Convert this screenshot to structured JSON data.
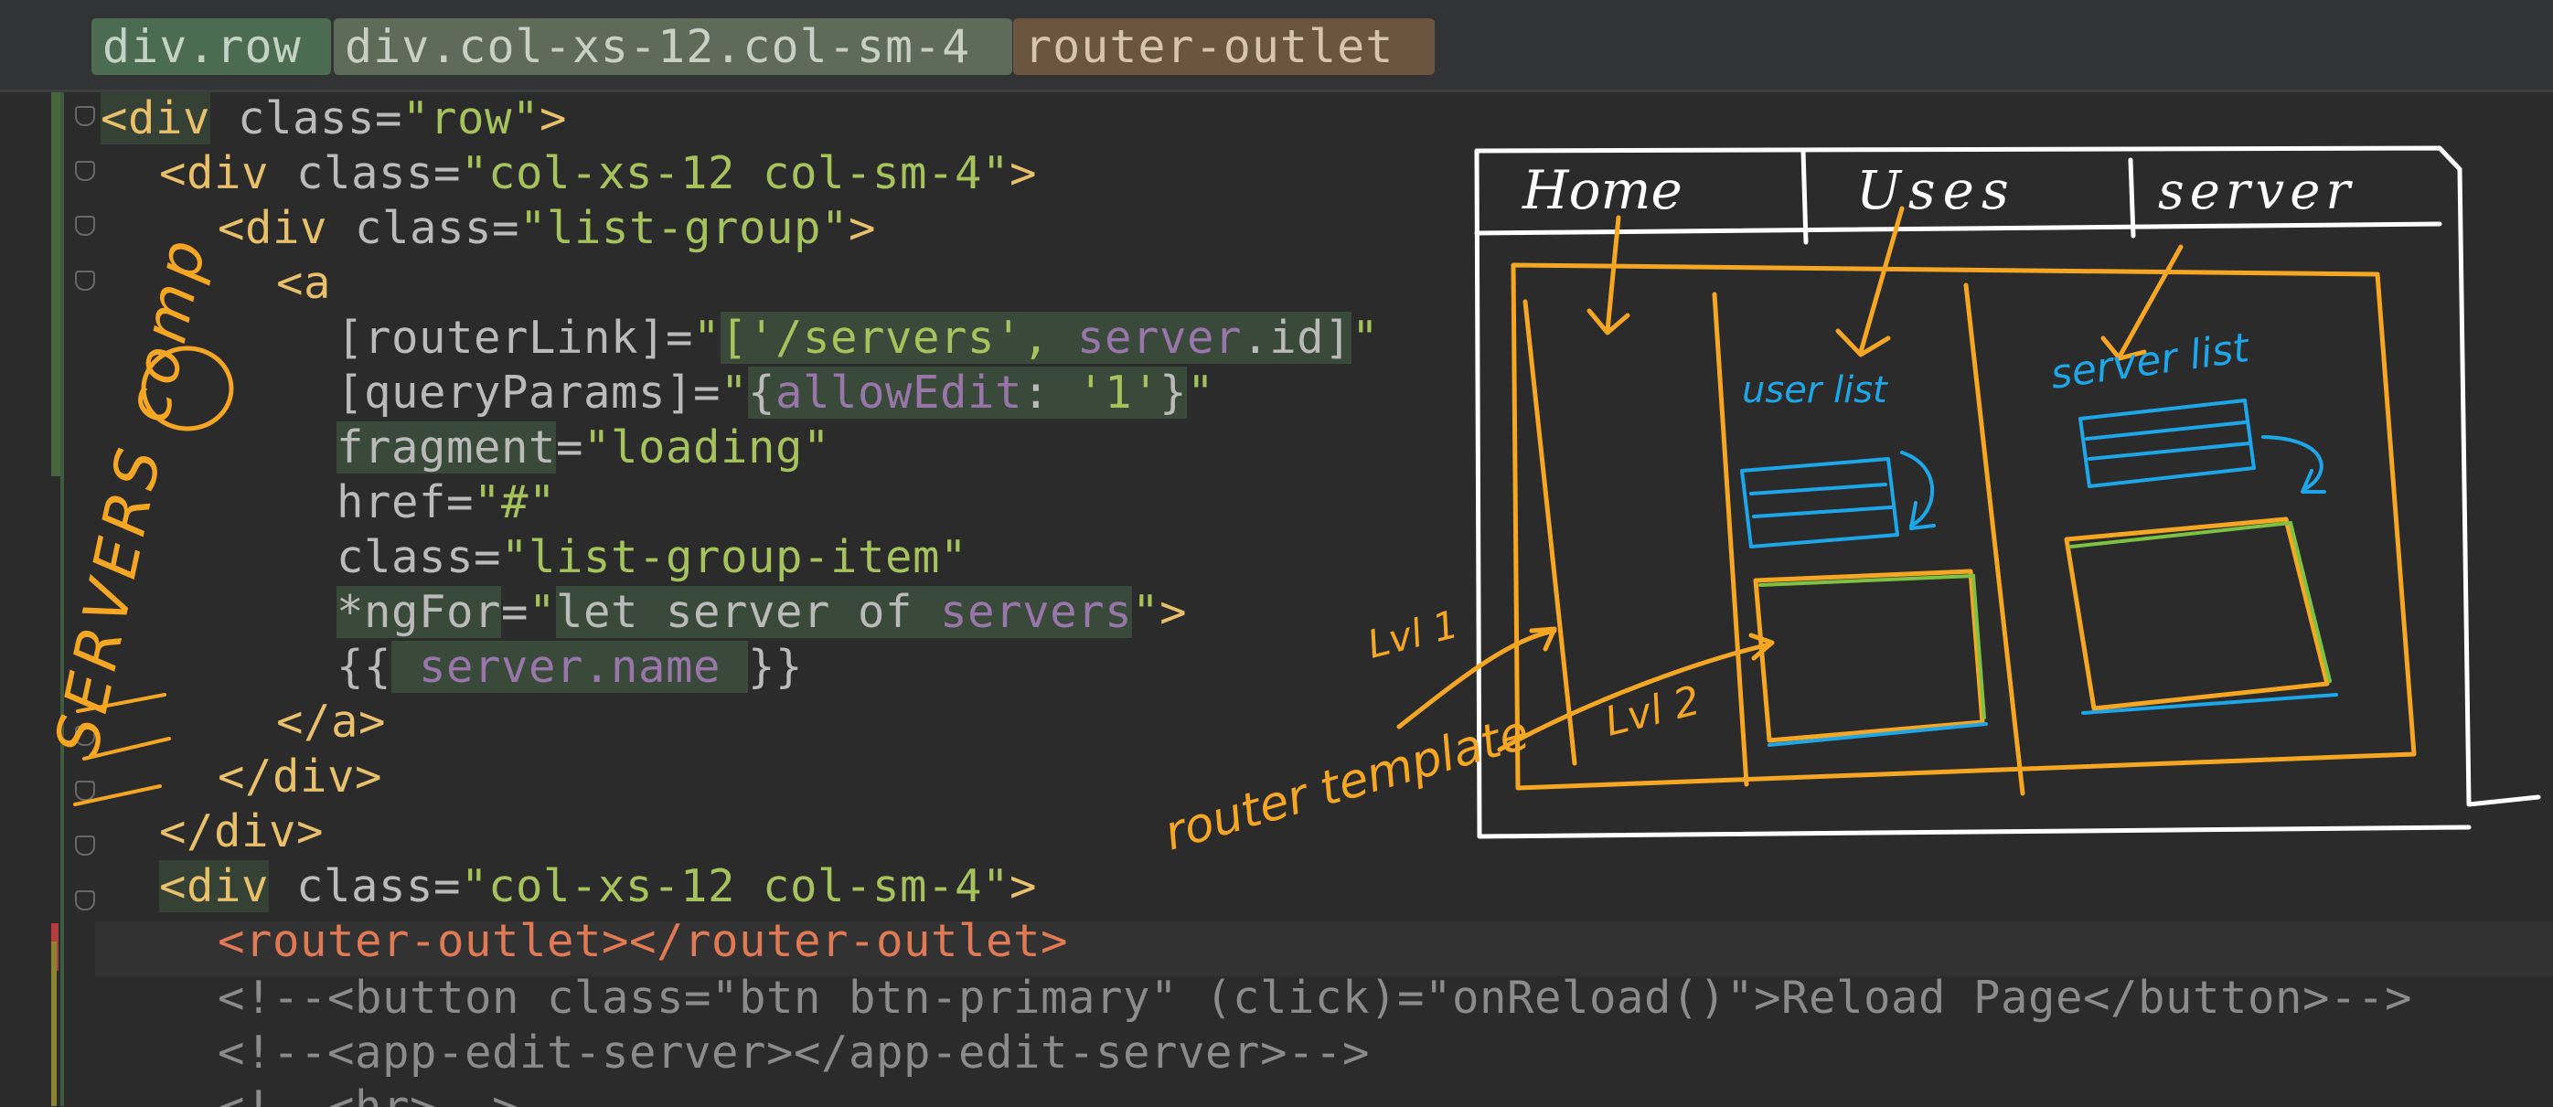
{
  "breadcrumbs": [
    "div.row",
    "div.col-xs-12.col-sm-4",
    "router-outlet"
  ],
  "code": {
    "l1_tag": "<div",
    "l1_attr": " class=",
    "l1_str": "\"row\"",
    "l1_end": ">",
    "l2_tag": "<div",
    "l2_attr": " class=",
    "l2_str": "\"col-xs-12 col-sm-4\"",
    "l2_end": ">",
    "l3_tag": "<div",
    "l3_attr": " class=",
    "l3_str": "\"list-group\"",
    "l3_end": ">",
    "l4_tag": "<a",
    "l5_attr": "[routerLink]=",
    "l5_q1": "\"",
    "l5_str": "['/servers', ",
    "l5_var": "server",
    "l5_rest": ".id]",
    "l5_q2": "\"",
    "l6_attr": "[queryParams]=",
    "l6_q1": "\"",
    "l6_a": "{",
    "l6_key": "allowEdit",
    "l6_b": ": ",
    "l6_val": "'1'",
    "l6_c": "}",
    "l6_q2": "\"",
    "l7_attr": "fragment",
    "l7_eq": "=",
    "l7_str": "\"loading\"",
    "l8_attr": "href=",
    "l8_str": "\"#\"",
    "l9_attr": "class=",
    "l9_str": "\"list-group-item\"",
    "l10_attr": "*ngFor",
    "l10_eq": "=",
    "l10_q1": "\"",
    "l10_str": "let server of ",
    "l10_var": "servers",
    "l10_q2": "\"",
    "l10_end": ">",
    "l11_open": "{{",
    "l11_var": " server.name ",
    "l11_close": "}}",
    "l12_tag": "</a>",
    "l13_tag": "</div>",
    "l14_tag": "</div>",
    "l15_tag": "<div",
    "l15_attr": " class=",
    "l15_str": "\"col-xs-12 col-sm-4\"",
    "l15_end": ">",
    "l16_tag": "<router-outlet></router-outlet>",
    "l17_comment": "<!--<button class=\"btn btn-primary\" (click)=\"onReload()\">Reload Page</button>-->",
    "l18_comment": "<!--<app-edit-server></app-edit-server>-->",
    "l19_comment": "<!--<hr>-->"
  },
  "annotations": {
    "nav_home": "Home",
    "nav_users": "Uses",
    "nav_servers": "server",
    "user_list": "user list",
    "server_list": "server list",
    "lvl1": "Lvl 1",
    "lvl2": "Lvl 2",
    "router_template": "router template",
    "servers_comp": "SERVERS comp"
  },
  "colors": {
    "background": "#2b2b2b",
    "tag": "#e8bf6a",
    "string": "#a5c25c",
    "attribute": "#bababa",
    "variable": "#9876aa",
    "comment": "#8b8b8b",
    "ink_white": "#ffffff",
    "ink_orange": "#f5a623",
    "ink_blue": "#1ea7e8",
    "ink_green": "#7dc242"
  }
}
